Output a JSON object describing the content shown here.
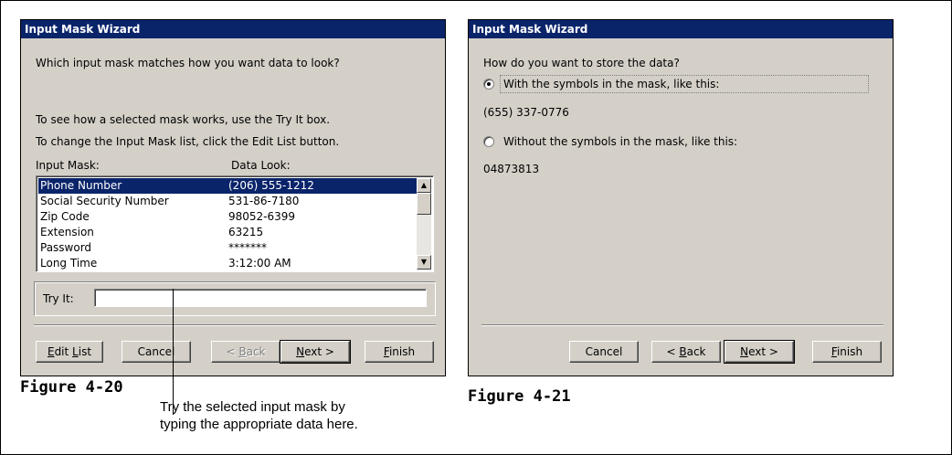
{
  "left_dialog": {
    "title": "Input Mask Wizard",
    "question": "Which input mask matches how you want data to look?",
    "hint1": "To see how a selected mask works, use the Try It box.",
    "hint2": "To change the Input Mask list, click the Edit List button.",
    "col1_header": "Input Mask:",
    "col2_header": "Data Look:",
    "rows": [
      {
        "mask": "Phone Number",
        "look": "(206) 555-1212",
        "selected": true
      },
      {
        "mask": "Social Security Number",
        "look": "531-86-7180"
      },
      {
        "mask": "Zip Code",
        "look": "98052-6399"
      },
      {
        "mask": "Extension",
        "look": "63215"
      },
      {
        "mask": "Password",
        "look": "*******"
      },
      {
        "mask": "Long Time",
        "look": "3:12:00 AM"
      }
    ],
    "try_it_label": "Try It:",
    "try_it_value": "",
    "buttons": {
      "edit_list": "Edit List",
      "cancel": "Cancel",
      "back": "< Back",
      "next": "Next >",
      "finish": "Finish"
    }
  },
  "right_dialog": {
    "title": "Input Mask Wizard",
    "question": "How do you want to store the data?",
    "option1": "With the symbols in the mask, like this:",
    "option1_example": "(655) 337-0776",
    "option2": "Without the symbols in the mask, like this:",
    "option2_example": "04873813",
    "selected_option": 1,
    "buttons": {
      "cancel": "Cancel",
      "back": "< Back",
      "next": "Next >",
      "finish": "Finish"
    }
  },
  "captions": {
    "figure_left": "Figure 4-20",
    "figure_right": "Figure 4-21",
    "callout_line1": "Try the selected input mask by",
    "callout_line2": "typing the appropriate data here."
  }
}
